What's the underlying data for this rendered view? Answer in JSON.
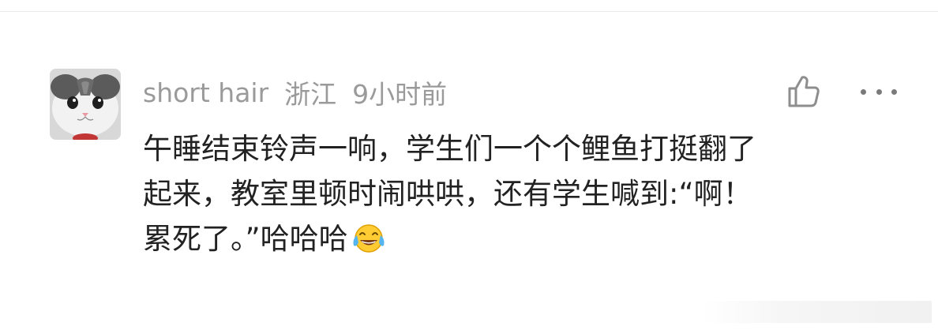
{
  "comment": {
    "username": "short hair",
    "location": "浙江",
    "time": "9小时前",
    "body_lines": [
      "午睡结束铃声一响，学生们一个个鲤鱼打挺翻了",
      "起来，教室里顿时闹哄哄，还有学生喊到:“啊！",
      "累死了。”哈哈哈"
    ],
    "emoji": "laughing-crying-emoji"
  },
  "actions": {
    "like_icon": "thumbs-up-icon",
    "more_icon": "more-dots-icon"
  },
  "colors": {
    "meta_text": "#9a9a9a",
    "body_text": "#222222",
    "divider": "#ececec"
  }
}
